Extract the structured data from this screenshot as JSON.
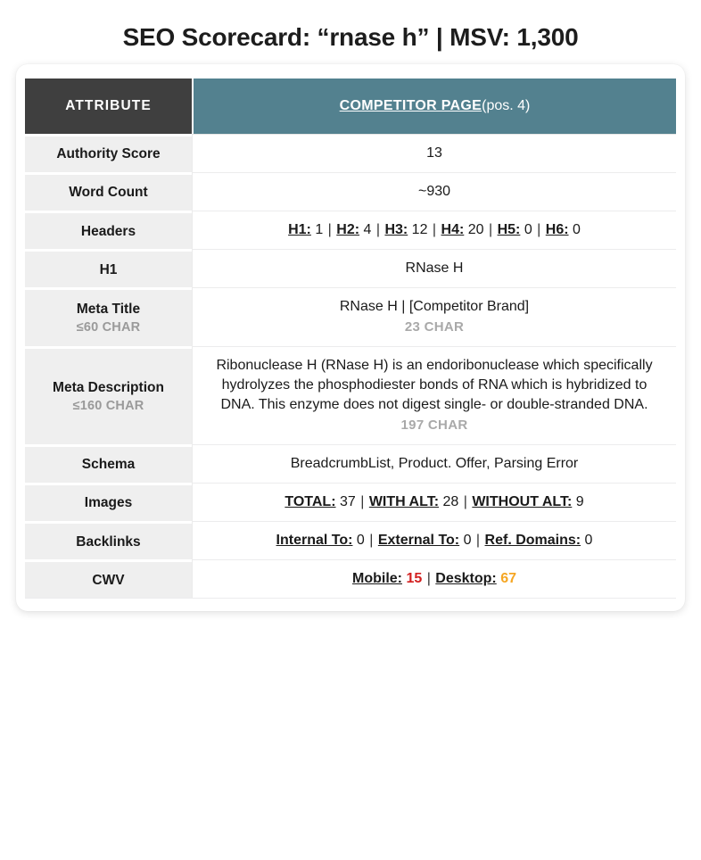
{
  "title": "SEO Scorecard: “rnase h” | MSV: 1,300",
  "table": {
    "headers": {
      "attribute": "ATTRIBUTE",
      "competitor_main": "COMPETITOR PAGE",
      "competitor_sub": "(pos. 4)"
    },
    "rows": [
      {
        "attribute": "Authority Score",
        "limit": "",
        "value": "13"
      },
      {
        "attribute": "Word Count",
        "limit": "",
        "value": "~930"
      },
      {
        "attribute": "Headers",
        "limit": "",
        "parts": [
          {
            "label": "H1:",
            "value": " 1"
          },
          {
            "label": "H2:",
            "value": " 4"
          },
          {
            "label": "H3:",
            "value": " 12"
          },
          {
            "label": "H4:",
            "value": " 20"
          },
          {
            "label": "H5:",
            "value": " 0"
          },
          {
            "label": "H6:",
            "value": " 0"
          }
        ]
      },
      {
        "attribute": "H1",
        "limit": "",
        "value": "RNase H"
      },
      {
        "attribute": "Meta Title",
        "limit": "≤60 CHAR",
        "value": "RNase H | [Competitor Brand]",
        "charcount": "23 CHAR"
      },
      {
        "attribute": "Meta Description",
        "limit": "≤160 CHAR",
        "value": "Ribonuclease H (RNase H) is an endoribonuclease which specifically hydrolyzes the phosphodiester bonds of RNA which is hybridized to DNA. This enzyme does not digest single- or double-stranded DNA.",
        "charcount": "197 CHAR"
      },
      {
        "attribute": "Schema",
        "limit": "",
        "value": "BreadcrumbList, Product. Offer, Parsing Error"
      },
      {
        "attribute": "Images",
        "limit": "",
        "parts": [
          {
            "label": "TOTAL:",
            "value": " 37"
          },
          {
            "label": "WITH ALT:",
            "value": " 28"
          },
          {
            "label": "WITHOUT ALT:",
            "value": " 9"
          }
        ]
      },
      {
        "attribute": "Backlinks",
        "limit": "",
        "parts": [
          {
            "label": "Internal To:",
            "value": " 0"
          },
          {
            "label": "External To:",
            "value": " 0"
          },
          {
            "label": "Ref. Domains:",
            "value": " 0"
          }
        ]
      },
      {
        "attribute": "CWV",
        "limit": "",
        "parts": [
          {
            "label": "Mobile:",
            "value": " 15",
            "color": "red"
          },
          {
            "label": "Desktop:",
            "value": " 67",
            "color": "orange"
          }
        ]
      }
    ],
    "separator": "|"
  },
  "colors": {
    "header_attribute_bg": "#3f3f3f",
    "header_value_bg": "#53818f",
    "attribute_cell_bg": "#efefef",
    "value_red": "#d32020",
    "value_orange": "#f5a623",
    "charcount_gray": "#a9a9a9"
  }
}
